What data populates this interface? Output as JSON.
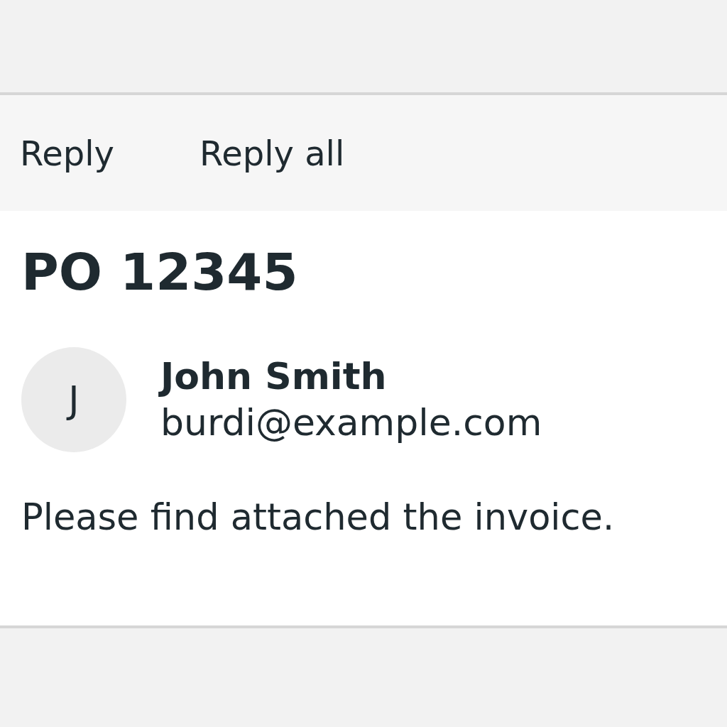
{
  "toolbar": {
    "actions": [
      {
        "label": "Reply"
      },
      {
        "label": "Reply all"
      }
    ]
  },
  "message": {
    "subject": "PO 12345",
    "sender": {
      "initial": "J",
      "name": "John Smith",
      "email": "burdi@example.com"
    },
    "body": "Please find attached the invoice."
  }
}
